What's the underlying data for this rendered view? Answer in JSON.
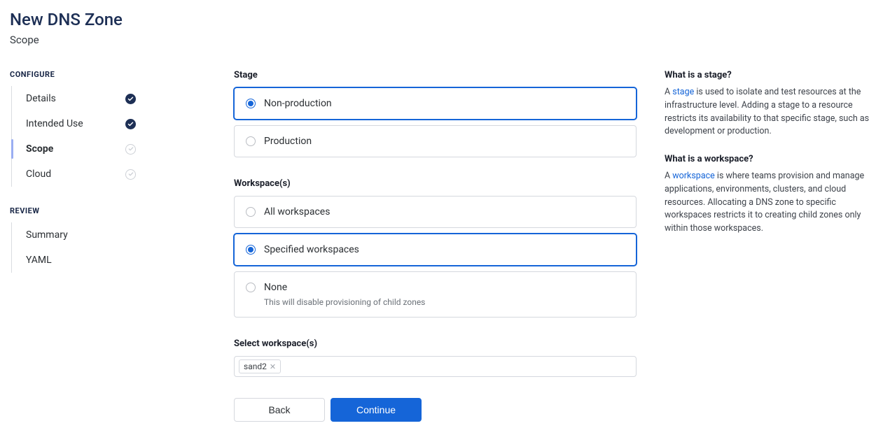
{
  "header": {
    "title": "New DNS Zone",
    "subtitle": "Scope"
  },
  "sidebar": {
    "sections": {
      "configure": {
        "label": "CONFIGURE",
        "items": [
          {
            "label": "Details",
            "status": "done"
          },
          {
            "label": "Intended Use",
            "status": "done"
          },
          {
            "label": "Scope",
            "status": "pending",
            "active": true
          },
          {
            "label": "Cloud",
            "status": "pending"
          }
        ]
      },
      "review": {
        "label": "REVIEW",
        "items": [
          {
            "label": "Summary"
          },
          {
            "label": "YAML"
          }
        ]
      }
    }
  },
  "form": {
    "stage": {
      "label": "Stage",
      "options": [
        {
          "label": "Non-production",
          "selected": true
        },
        {
          "label": "Production",
          "selected": false
        }
      ]
    },
    "workspaces": {
      "label": "Workspace(s)",
      "options": [
        {
          "label": "All workspaces",
          "selected": false
        },
        {
          "label": "Specified workspaces",
          "selected": true
        },
        {
          "label": "None",
          "selected": false,
          "subtext": "This will disable provisioning of child zones"
        }
      ]
    },
    "selectWorkspaces": {
      "label": "Select workspace(s)",
      "chips": [
        "sand2"
      ]
    },
    "buttons": {
      "back": "Back",
      "continue": "Continue"
    }
  },
  "help": {
    "stage": {
      "heading": "What is a stage?",
      "prefix": "A ",
      "linkText": "stage",
      "suffix": " is used to isolate and test resources at the infrastructure level. Adding a stage to a resource restricts its availability to that specific stage, such as development or production."
    },
    "workspace": {
      "heading": "What is a workspace?",
      "prefix": "A ",
      "linkText": "workspace",
      "suffix": " is where teams provision and manage applications, environments, clusters, and cloud resources. Allocating a DNS zone to specific workspaces restricts it to creating child zones only within those workspaces."
    }
  }
}
